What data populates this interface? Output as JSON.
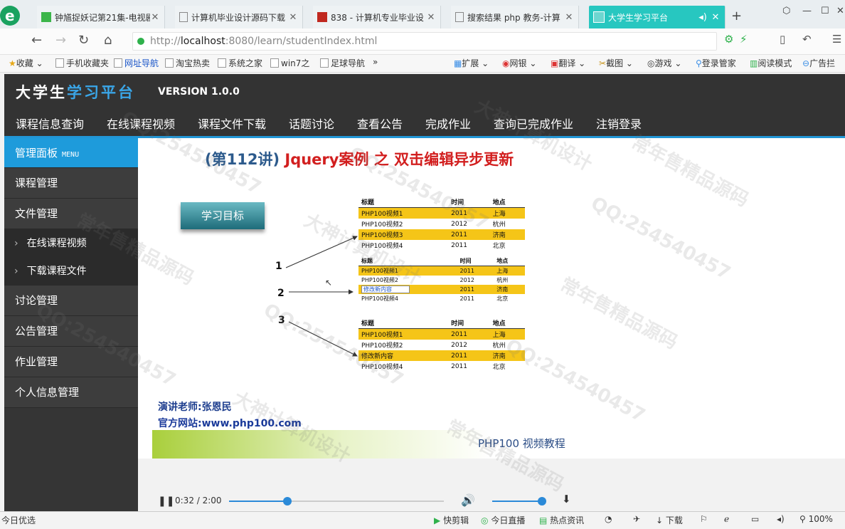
{
  "browser": {
    "tabs": [
      {
        "title": "钟馗捉妖记第21集-电视剧",
        "active": false
      },
      {
        "title": "计算机毕业设计源码下载",
        "active": false
      },
      {
        "title": "838 - 计算机专业毕业设",
        "active": false
      },
      {
        "title": "搜索结果 php 教务-计算",
        "active": false
      },
      {
        "title": "大学生学习平台",
        "active": true
      }
    ],
    "url_prefix": "http://",
    "url_host": "localhost",
    "url_rest": ":8080/learn/studentIndex.html",
    "bookmarks": [
      "收藏",
      "手机收藏夹",
      "网址导航",
      "淘宝热卖",
      "系统之家",
      "win7之",
      "足球导航",
      "»"
    ],
    "extensions": [
      "扩展",
      "网银",
      "翻译",
      "截图",
      "游戏",
      "登录管家",
      "阅读模式",
      "广告拦"
    ]
  },
  "site": {
    "logo_a": "大学生",
    "logo_b": "学习平台",
    "version": "VERSION 1.0.0",
    "nav": [
      "课程信息查询",
      "在线课程视频",
      "课程文件下载",
      "话题讨论",
      "查看公告",
      "完成作业",
      "查询已完成作业",
      "注销登录"
    ]
  },
  "sidebar": {
    "header": "管理面板",
    "header_sub": "MENU",
    "items": [
      "课程管理",
      "文件管理"
    ],
    "sub_items": [
      "在线课程视频",
      "下载课程文件"
    ],
    "items2": [
      "讨论管理",
      "公告管理",
      "作业管理",
      "个人信息管理"
    ]
  },
  "slide": {
    "title_a": "(第",
    "title_num": "112",
    "title_b": "讲)",
    "title_red": "Jquery案例 之 双击编辑异步更新",
    "goal": "学习目标",
    "steps": [
      "1",
      "2",
      "3"
    ],
    "table_headers": [
      "标题",
      "时间",
      "地点"
    ],
    "table1": [
      [
        "PHP100视频1",
        "2011",
        "上海"
      ],
      [
        "PHP100视频2",
        "2012",
        "杭州"
      ],
      [
        "PHP100视频3",
        "2011",
        "济南"
      ],
      [
        "PHP100视频4",
        "2011",
        "北京"
      ]
    ],
    "table2": [
      [
        "PHP100视频1",
        "2011",
        "上海"
      ],
      [
        "PHP100视频2",
        "2012",
        "杭州"
      ],
      [
        "修改新内容",
        "2011",
        "济南"
      ],
      [
        "PHP100视频4",
        "2011",
        "北京"
      ]
    ],
    "table3": [
      [
        "PHP100视频1",
        "2011",
        "上海"
      ],
      [
        "PHP100视频2",
        "2012",
        "杭州"
      ],
      [
        "修改新内容",
        "2011",
        "济南"
      ],
      [
        "PHP100视频4",
        "2011",
        "北京"
      ]
    ],
    "teacher_label": "演讲老师:",
    "teacher": "张恩民",
    "site_label": "官方网站:",
    "site_url": "www.php100.com",
    "brand_a": "PHP100",
    "brand_b": " 视频教程"
  },
  "player": {
    "time": "0:32 / 2:00",
    "progress_fraction": 0.27,
    "volume_fraction": 0.92
  },
  "statusbar": {
    "left": "今日优选",
    "items": [
      "快剪辑",
      "今日直播",
      "热点资讯",
      "下载",
      "100%"
    ]
  },
  "watermarks": [
    "QQ:254540457",
    "大神计算机设计",
    "常年售精品源码"
  ]
}
